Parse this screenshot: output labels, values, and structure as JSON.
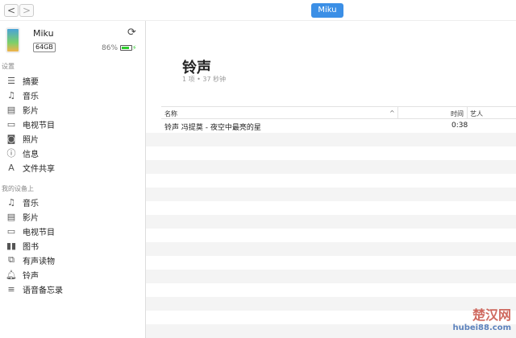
{
  "toolbar": {
    "back": "<",
    "forward": ">",
    "device_button": "Miku"
  },
  "device": {
    "name": "Miku",
    "capacity": "64GB",
    "battery": "86%",
    "battery_level": 0.86,
    "battery_color": "#2ecc2e"
  },
  "sidebar": {
    "settings_header": "设置",
    "settings": [
      {
        "icon": "list-icon",
        "glyph": "☰",
        "label": "摘要"
      },
      {
        "icon": "music-note-icon",
        "glyph": "♫",
        "label": "音乐"
      },
      {
        "icon": "film-icon",
        "glyph": "▤",
        "label": "影片"
      },
      {
        "icon": "tv-icon",
        "glyph": "▭",
        "label": "电视节目"
      },
      {
        "icon": "camera-icon",
        "glyph": "◙",
        "label": "照片"
      },
      {
        "icon": "info-icon",
        "glyph": "ⓘ",
        "label": "信息"
      },
      {
        "icon": "app-store-icon",
        "glyph": "A",
        "label": "文件共享"
      }
    ],
    "device_header": "我的设备上",
    "device_items": [
      {
        "icon": "music-note-icon",
        "glyph": "♫",
        "label": "音乐"
      },
      {
        "icon": "film-icon",
        "glyph": "▤",
        "label": "影片"
      },
      {
        "icon": "tv-icon",
        "glyph": "▭",
        "label": "电视节目"
      },
      {
        "icon": "book-icon",
        "glyph": "▮▮",
        "label": "图书"
      },
      {
        "icon": "audiobook-icon",
        "glyph": "⧉",
        "label": "有声读物"
      },
      {
        "icon": "bell-icon",
        "glyph": "🔔︎",
        "label": "铃声"
      },
      {
        "icon": "voice-memo-icon",
        "glyph": "≡",
        "label": "语音备忘录"
      }
    ]
  },
  "main": {
    "title": "铃声",
    "subtitle": "1 项 • 37 秒钟",
    "columns": {
      "name": "名称",
      "time": "时间",
      "artist": "艺人"
    },
    "rows": [
      {
        "name": "铃声 冯提莫 - 夜空中最亮的星",
        "time": "0:38",
        "artist": ""
      }
    ]
  },
  "watermark": {
    "brand": "楚汉网",
    "url": "hubei88.com"
  }
}
